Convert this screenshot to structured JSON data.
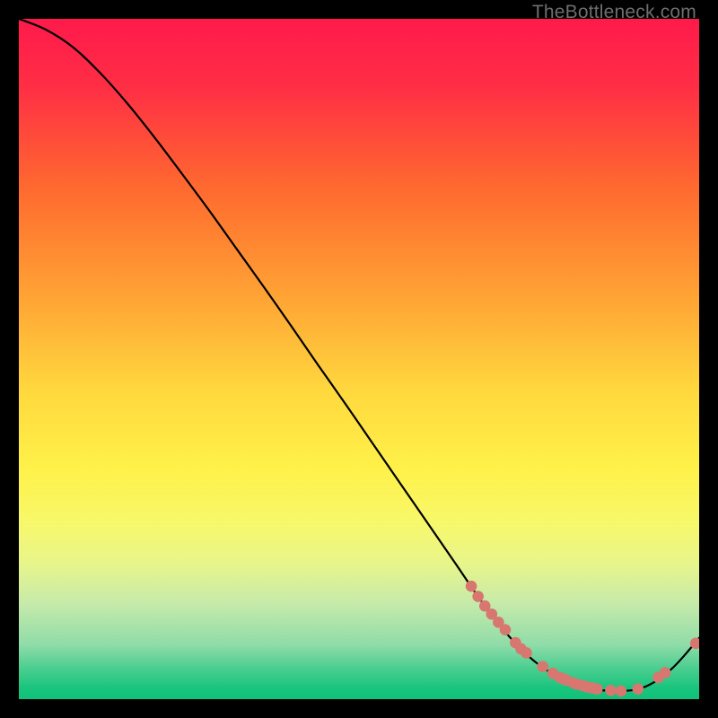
{
  "watermark": "TheBottleneck.com",
  "chart_data": {
    "type": "line",
    "title": "",
    "xlabel": "",
    "ylabel": "",
    "xlim": [
      0,
      100
    ],
    "ylim": [
      0,
      100
    ],
    "grid": false,
    "legend": false,
    "gradient_stops": [
      {
        "offset": 0.0,
        "color": "#ff1a4b"
      },
      {
        "offset": 0.1,
        "color": "#ff2e45"
      },
      {
        "offset": 0.25,
        "color": "#ff6a2f"
      },
      {
        "offset": 0.4,
        "color": "#ffa034"
      },
      {
        "offset": 0.55,
        "color": "#ffd93e"
      },
      {
        "offset": 0.66,
        "color": "#fff149"
      },
      {
        "offset": 0.74,
        "color": "#f7f86a"
      },
      {
        "offset": 0.8,
        "color": "#e8f58a"
      },
      {
        "offset": 0.86,
        "color": "#c6eaaa"
      },
      {
        "offset": 0.92,
        "color": "#8fdca8"
      },
      {
        "offset": 0.955,
        "color": "#4ace90"
      },
      {
        "offset": 0.985,
        "color": "#18c47d"
      },
      {
        "offset": 1.0,
        "color": "#0fc27a"
      }
    ],
    "series": [
      {
        "name": "curve",
        "type": "line",
        "color": "#000000",
        "x": [
          0,
          4,
          8,
          12,
          16,
          20,
          24,
          28,
          32,
          36,
          40,
          44,
          48,
          52,
          56,
          60,
          64,
          68,
          72,
          76,
          80,
          84,
          88,
          92,
          96,
          100
        ],
        "y": [
          100.0,
          98.4,
          95.8,
          92.0,
          87.5,
          82.5,
          77.2,
          71.8,
          66.2,
          60.6,
          54.9,
          49.1,
          43.4,
          37.6,
          31.8,
          26.0,
          20.2,
          14.4,
          9.3,
          5.4,
          2.9,
          1.6,
          1.2,
          1.8,
          4.5,
          9.0
        ]
      },
      {
        "name": "markers",
        "type": "scatter",
        "color": "#d77770",
        "x": [
          66.5,
          67.5,
          68.5,
          69.5,
          70.5,
          71.5,
          73.0,
          73.8,
          74.6,
          77.0,
          78.5,
          79.5,
          80.0,
          80.5,
          81.5,
          82.0,
          82.8,
          83.5,
          84.0,
          84.5,
          85.0,
          87.0,
          88.5,
          91.0,
          94.0,
          95.0,
          99.5
        ],
        "y": [
          16.6,
          15.1,
          13.7,
          12.5,
          11.3,
          10.2,
          8.3,
          7.4,
          6.8,
          4.8,
          3.8,
          3.2,
          3.0,
          2.8,
          2.4,
          2.2,
          2.0,
          1.8,
          1.7,
          1.6,
          1.5,
          1.3,
          1.2,
          1.5,
          3.2,
          3.9,
          8.2
        ]
      }
    ]
  }
}
